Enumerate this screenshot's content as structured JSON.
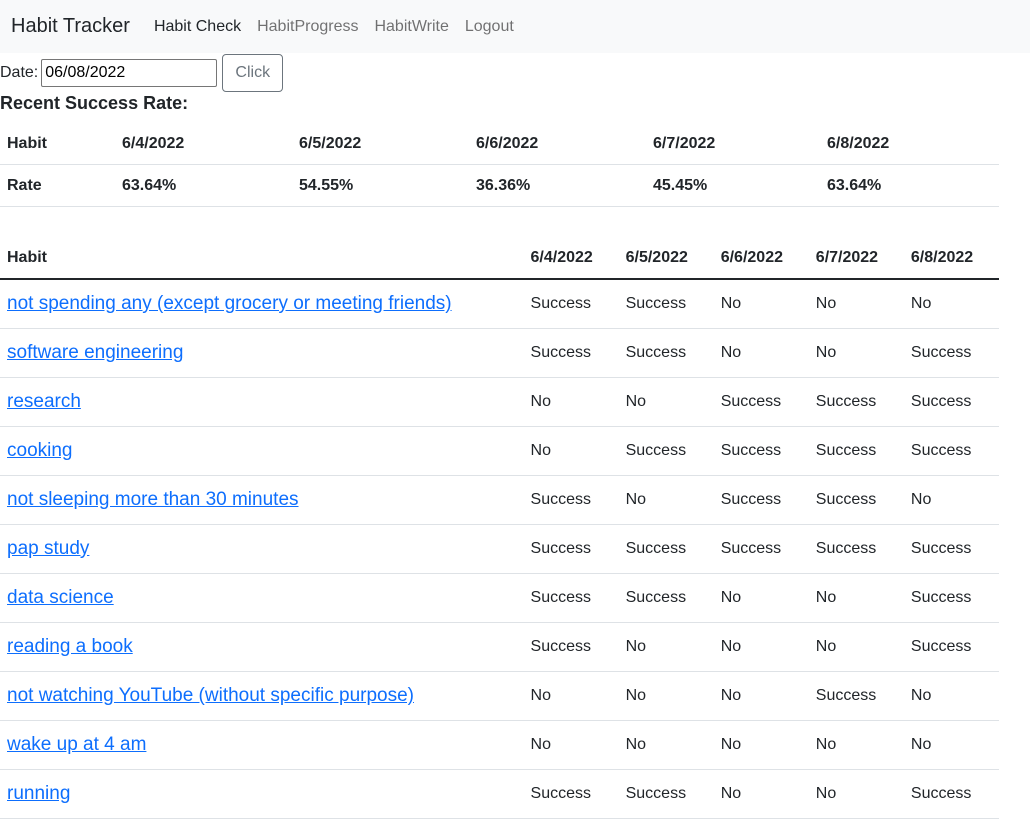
{
  "navbar": {
    "brand": "Habit Tracker",
    "links": [
      {
        "label": "Habit Check",
        "active": true
      },
      {
        "label": "HabitProgress",
        "active": false
      },
      {
        "label": "HabitWrite",
        "active": false
      },
      {
        "label": "Logout",
        "active": false
      }
    ]
  },
  "date_form": {
    "label": "Date:",
    "value": "06/08/2022",
    "button_label": "Click"
  },
  "rate_section": {
    "title": "Recent Success Rate:",
    "headers": [
      "Habit",
      "6/4/2022",
      "6/5/2022",
      "6/6/2022",
      "6/7/2022",
      "6/8/2022"
    ],
    "row": [
      "Rate",
      "63.64%",
      "54.55%",
      "36.36%",
      "45.45%",
      "63.64%"
    ]
  },
  "habit_table": {
    "headers": [
      "Habit",
      "6/4/2022",
      "6/5/2022",
      "6/6/2022",
      "6/7/2022",
      "6/8/2022"
    ],
    "rows": [
      {
        "name": "not spending any (except grocery or meeting friends)",
        "values": [
          "Success",
          "Success",
          "No",
          "No",
          "No"
        ]
      },
      {
        "name": "software engineering",
        "values": [
          "Success",
          "Success",
          "No",
          "No",
          "Success"
        ]
      },
      {
        "name": "research",
        "values": [
          "No",
          "No",
          "Success",
          "Success",
          "Success"
        ]
      },
      {
        "name": "cooking",
        "values": [
          "No",
          "Success",
          "Success",
          "Success",
          "Success"
        ]
      },
      {
        "name": "not sleeping more than 30 minutes",
        "values": [
          "Success",
          "No",
          "Success",
          "Success",
          "No"
        ]
      },
      {
        "name": "pap study",
        "values": [
          "Success",
          "Success",
          "Success",
          "Success",
          "Success"
        ]
      },
      {
        "name": "data science",
        "values": [
          "Success",
          "Success",
          "No",
          "No",
          "Success"
        ]
      },
      {
        "name": "reading a book",
        "values": [
          "Success",
          "No",
          "No",
          "No",
          "Success"
        ]
      },
      {
        "name": "not watching YouTube (without specific purpose)",
        "values": [
          "No",
          "No",
          "No",
          "Success",
          "No"
        ]
      },
      {
        "name": "wake up at 4 am",
        "values": [
          "No",
          "No",
          "No",
          "No",
          "No"
        ]
      },
      {
        "name": "running",
        "values": [
          "Success",
          "Success",
          "No",
          "No",
          "Success"
        ]
      }
    ]
  }
}
